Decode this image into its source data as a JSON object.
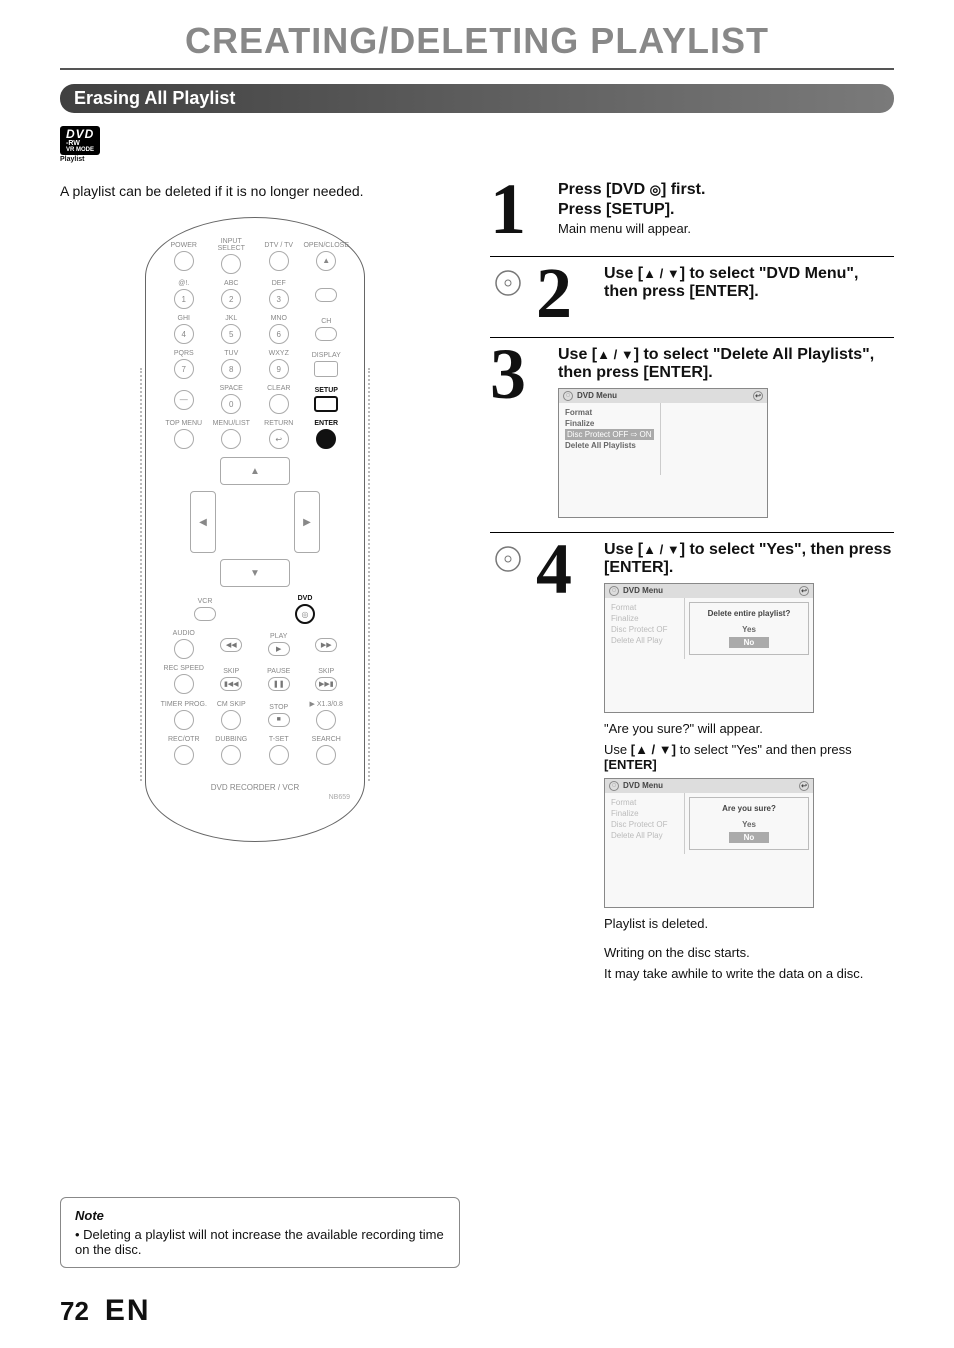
{
  "page_title": "CREATING/DELETING PLAYLIST",
  "section_bar": "Erasing All Playlist",
  "dvd_badge": {
    "dvd": "DVD",
    "rw": "-RW",
    "vr": "VR MODE",
    "playlist": "Playlist"
  },
  "intro": "A playlist can be deleted if it is no longer needed.",
  "remote": {
    "row1": {
      "a": "POWER",
      "b": "INPUT\nSELECT",
      "c": "DTV / TV",
      "d": "OPEN/CLOSE"
    },
    "row2": {
      "a": "@!.",
      "b": "ABC",
      "c": "DEF"
    },
    "row3": {
      "a": "GHI",
      "b": "JKL",
      "c": "MNO",
      "d": "CH"
    },
    "row4": {
      "a": "PQRS",
      "b": "TUV",
      "c": "WXYZ",
      "d": "DISPLAY"
    },
    "row5": {
      "a": "SPACE",
      "b": "CLEAR",
      "c": "SETUP"
    },
    "row6": {
      "a": "TOP MENU",
      "b": "MENU/LIST",
      "c": "RETURN",
      "d": "ENTER"
    },
    "row7": {
      "a": "VCR",
      "b": "DVD"
    },
    "row8": {
      "a": "AUDIO",
      "b": "PLAY"
    },
    "row9": {
      "a": "REC SPEED",
      "b": "SKIP",
      "c": "PAUSE",
      "d": "SKIP"
    },
    "row10": {
      "a": "TIMER PROG.",
      "b": "CM SKIP",
      "c": "STOP",
      "d": "▶ X1.3/0.8"
    },
    "row11": {
      "a": "REC/OTR",
      "b": "DUBBING",
      "c": "T-SET",
      "d": "SEARCH"
    },
    "footer": "DVD RECORDER / VCR",
    "model": "NB659",
    "keys": {
      "1": "1",
      "2": "2",
      "3": "3",
      "4": "4",
      "5": "5",
      "6": "6",
      "7": "7",
      "8": "8",
      "9": "9",
      "0": "0"
    }
  },
  "steps": {
    "s1": {
      "num": "1",
      "line1_a": "Press [DVD ",
      "line1_b": "] first.",
      "line2": "Press [SETUP].",
      "line3": "Main menu will appear."
    },
    "s2": {
      "num": "2",
      "line1_a": "Use [",
      "arrows": "▲ / ▼",
      "line1_b": "] to select \"DVD Menu\", then press [ENTER]."
    },
    "s3": {
      "num": "3",
      "line1_a": "Use [",
      "arrows": "▲ / ▼",
      "line1_b": "] to select \"Delete All Playlists\", then press [ENTER].",
      "screen_title": "DVD Menu",
      "menu": {
        "a": "Format",
        "b": "Finalize",
        "c": "Disc Protect OFF ⇨ ON",
        "d": "Delete All Playlists"
      }
    },
    "s4": {
      "num": "4",
      "line1_a": "Use [",
      "arrows": "▲ / ▼",
      "line1_b": "] to select \"Yes\", then press [ENTER].",
      "screen_title": "DVD Menu",
      "menu": {
        "a": "Format",
        "b": "Finalize",
        "c": "Disc Protect OF",
        "d": "Delete All Play"
      },
      "dialog1_q": "Delete entire playlist?",
      "opt_yes": "Yes",
      "opt_no": "No",
      "after1": "\"Are you sure?\" will appear.",
      "after2_a": "Use ",
      "after2_arrows": "[▲ / ▼]",
      "after2_b": " to select \"Yes\" and then press ",
      "after2_c": "[ENTER]",
      "dialog2_q": "Are you sure?",
      "after3": "Playlist is deleted.",
      "after4": "Writing on the disc starts.",
      "after5": "It may take awhile to write the data on a disc."
    }
  },
  "note": {
    "title": "Note",
    "item": "Deleting a playlist will not increase the available recording time on the disc."
  },
  "footer": {
    "page": "72",
    "lang": "EN"
  }
}
